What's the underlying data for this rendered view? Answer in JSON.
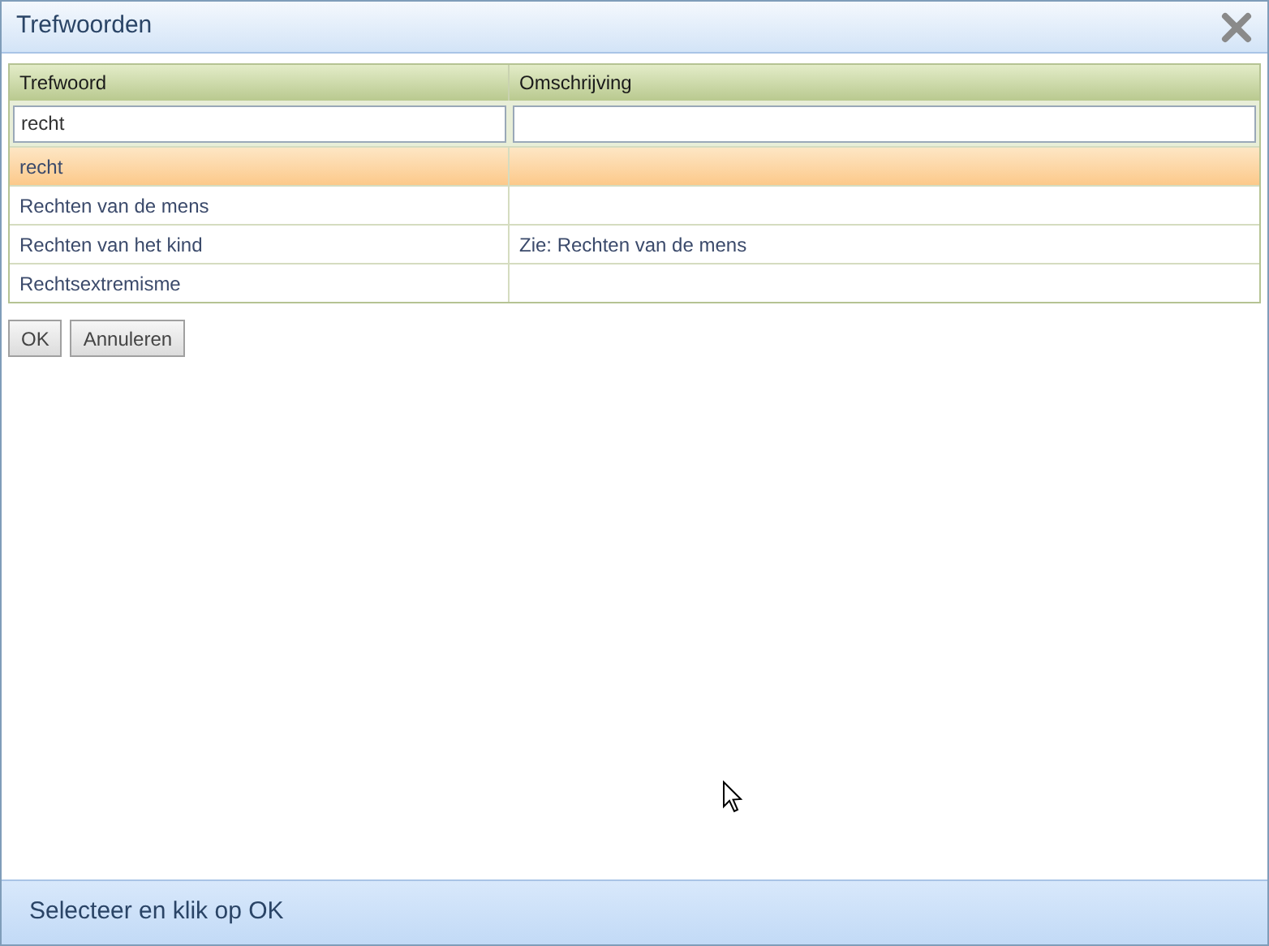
{
  "window": {
    "title": "Trefwoorden"
  },
  "table": {
    "columns": [
      {
        "label": "Trefwoord",
        "filter": "recht"
      },
      {
        "label": "Omschrijving"
      }
    ],
    "rows": [
      {
        "cells": [
          "recht",
          null
        ],
        "selected": true
      },
      {
        "cells": [
          "Rechten van de mens",
          null
        ],
        "selected": false
      },
      {
        "cells": [
          "Rechten van het kind",
          "Zie: Rechten van de mens"
        ],
        "selected": false
      },
      {
        "cells": [
          "Rechtsextremisme",
          null
        ],
        "selected": false
      }
    ]
  },
  "buttons": [
    "OK",
    "Annuleren"
  ],
  "status_bar": "Selecteer en klik op OK"
}
